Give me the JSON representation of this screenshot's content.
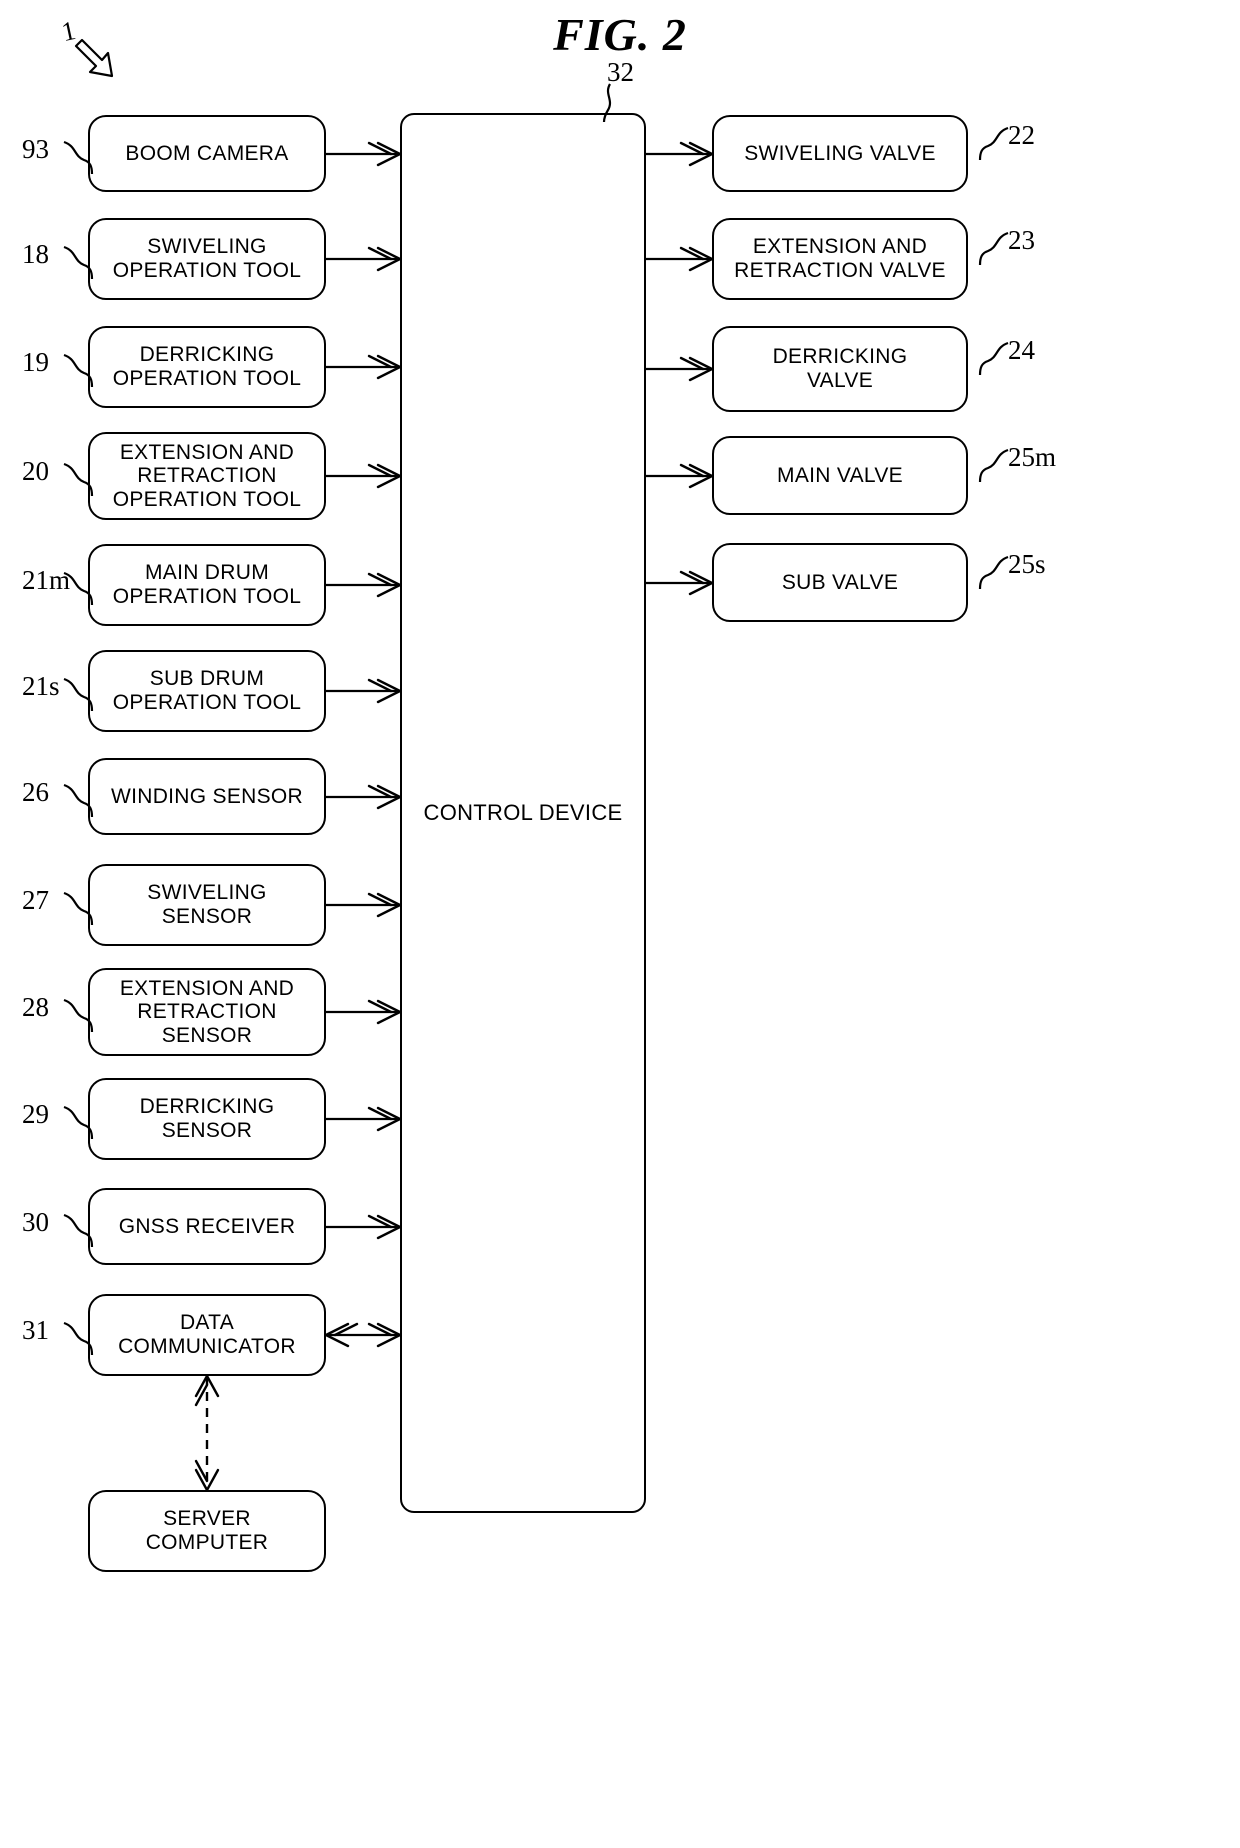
{
  "figure": {
    "title": "FIG. 2",
    "top_reference": "1"
  },
  "control": {
    "label": "CONTROL DEVICE",
    "ref": "32"
  },
  "inputs": [
    {
      "ref": "93",
      "label": "BOOM CAMERA",
      "arrow": "single"
    },
    {
      "ref": "18",
      "label": "SWIVELING\nOPERATION TOOL",
      "arrow": "single"
    },
    {
      "ref": "19",
      "label": "DERRICKING\nOPERATION TOOL",
      "arrow": "single"
    },
    {
      "ref": "20",
      "label": "EXTENSION AND\nRETRACTION\nOPERATION TOOL",
      "arrow": "single"
    },
    {
      "ref": "21m",
      "label": "MAIN DRUM\nOPERATION TOOL",
      "arrow": "single"
    },
    {
      "ref": "21s",
      "label": "SUB DRUM\nOPERATION TOOL",
      "arrow": "single"
    },
    {
      "ref": "26",
      "label": "WINDING SENSOR",
      "arrow": "single"
    },
    {
      "ref": "27",
      "label": "SWIVELING\nSENSOR",
      "arrow": "single"
    },
    {
      "ref": "28",
      "label": "EXTENSION AND\nRETRACTION\nSENSOR",
      "arrow": "single"
    },
    {
      "ref": "29",
      "label": "DERRICKING\nSENSOR",
      "arrow": "single"
    },
    {
      "ref": "30",
      "label": "GNSS RECEIVER",
      "arrow": "single"
    },
    {
      "ref": "31",
      "label": "DATA\nCOMMUNICATOR",
      "arrow": "double"
    }
  ],
  "outputs": [
    {
      "ref": "22",
      "label": "SWIVELING VALVE"
    },
    {
      "ref": "23",
      "label": "EXTENSION AND\nRETRACTION VALVE"
    },
    {
      "ref": "24",
      "label": "DERRICKING\nVALVE"
    },
    {
      "ref": "25m",
      "label": "MAIN VALVE"
    },
    {
      "ref": "25s",
      "label": "SUB VALVE"
    }
  ],
  "server": {
    "label": "SERVER\nCOMPUTER"
  },
  "colors": {
    "line": "#000000",
    "background": "#ffffff"
  }
}
